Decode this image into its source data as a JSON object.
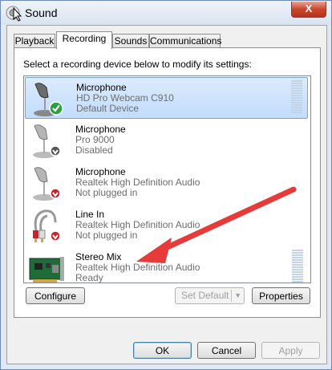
{
  "window": {
    "title": "Sound",
    "close_glyph": "X"
  },
  "tabs": [
    {
      "label": "Playback",
      "active": false
    },
    {
      "label": "Recording",
      "active": true
    },
    {
      "label": "Sounds",
      "active": false
    },
    {
      "label": "Communications",
      "active": false
    }
  ],
  "instruction": "Select a recording device below to modify its settings:",
  "devices": [
    {
      "name": "Microphone",
      "sub": "HD Pro Webcam C910",
      "status": "Default Device",
      "icon": "microphone-icon",
      "badge": "default-check-icon",
      "selected": true,
      "meter": true
    },
    {
      "name": "Microphone",
      "sub": "Pro 9000",
      "status": "Disabled",
      "icon": "microphone-icon",
      "badge": "disabled-arrow-icon",
      "selected": false,
      "meter": false
    },
    {
      "name": "Microphone",
      "sub": "Realtek High Definition Audio",
      "status": "Not plugged in",
      "icon": "microphone-icon",
      "badge": "unplugged-arrow-icon",
      "selected": false,
      "meter": false
    },
    {
      "name": "Line In",
      "sub": "Realtek High Definition Audio",
      "status": "Not plugged in",
      "icon": "line-in-cable-icon",
      "badge": "unplugged-arrow-icon",
      "selected": false,
      "meter": false
    },
    {
      "name": "Stereo Mix",
      "sub": "Realtek High Definition Audio",
      "status": "Ready",
      "icon": "sound-card-icon",
      "badge": "",
      "selected": false,
      "meter": true
    }
  ],
  "buttons": {
    "configure": "Configure",
    "set_default": "Set Default",
    "properties": "Properties",
    "ok": "OK",
    "cancel": "Cancel",
    "apply": "Apply"
  },
  "colors": {
    "annotation_arrow": "#e53b3b",
    "selection": "#c1dcfc"
  }
}
